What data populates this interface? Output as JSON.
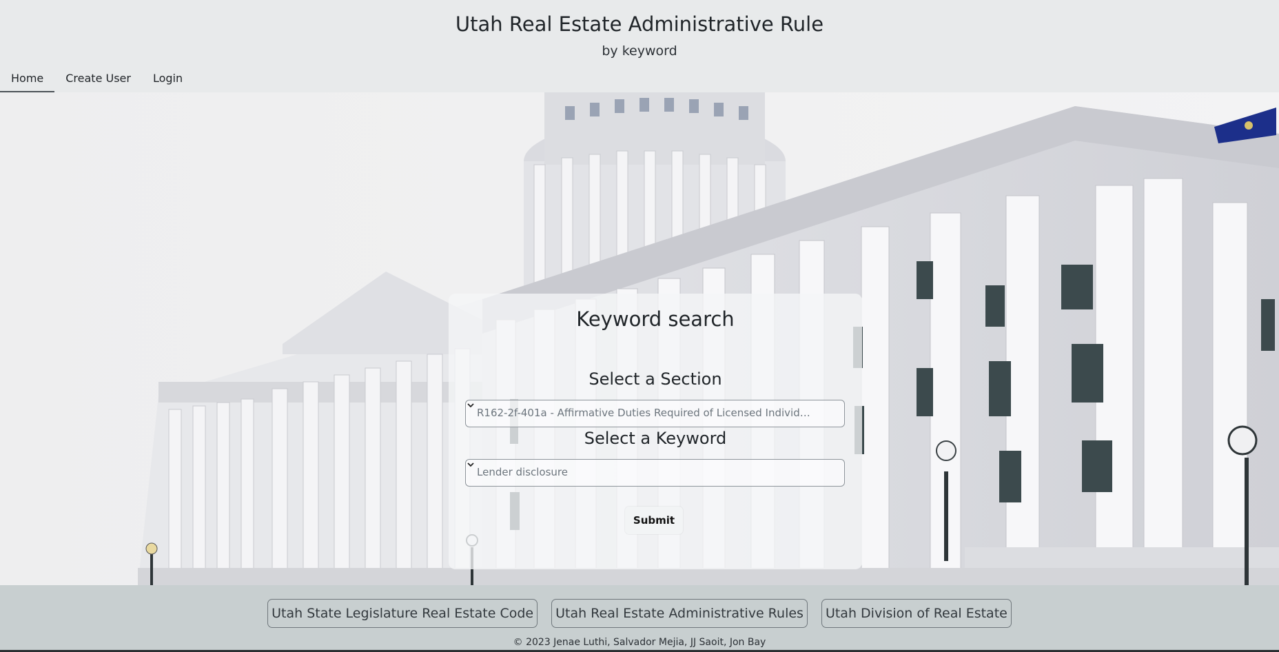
{
  "header": {
    "title": "Utah Real Estate Administrative Rule",
    "subtitle": "by keyword"
  },
  "nav": {
    "items": [
      {
        "label": "Home",
        "active": true
      },
      {
        "label": "Create User",
        "active": false
      },
      {
        "label": "Login",
        "active": false
      }
    ]
  },
  "search": {
    "title": "Keyword search",
    "section_label": "Select a Section",
    "section_value": "R162-2f-401a - Affirmative Duties Required of Licensed Individuals.",
    "keyword_label": "Select a Keyword",
    "keyword_value": "Lender disclosure",
    "submit_label": "Submit"
  },
  "footer": {
    "links": [
      "Utah State Legislature Real Estate Code",
      "Utah Real Estate Administrative Rules",
      "Utah Division of Real Estate"
    ],
    "copyright": "© 2023 Jenae Luthi, Salvador Mejia, JJ Saoit, Jon Bay"
  },
  "icons": {
    "select_chevron": "chevron-down-icon",
    "flag": "flag-icon"
  },
  "colors": {
    "header_bg": "#e8eaeb",
    "footer_bg": "#c8cfd0",
    "text": "#1f2428",
    "flag_blue": "#1c2f8a"
  }
}
